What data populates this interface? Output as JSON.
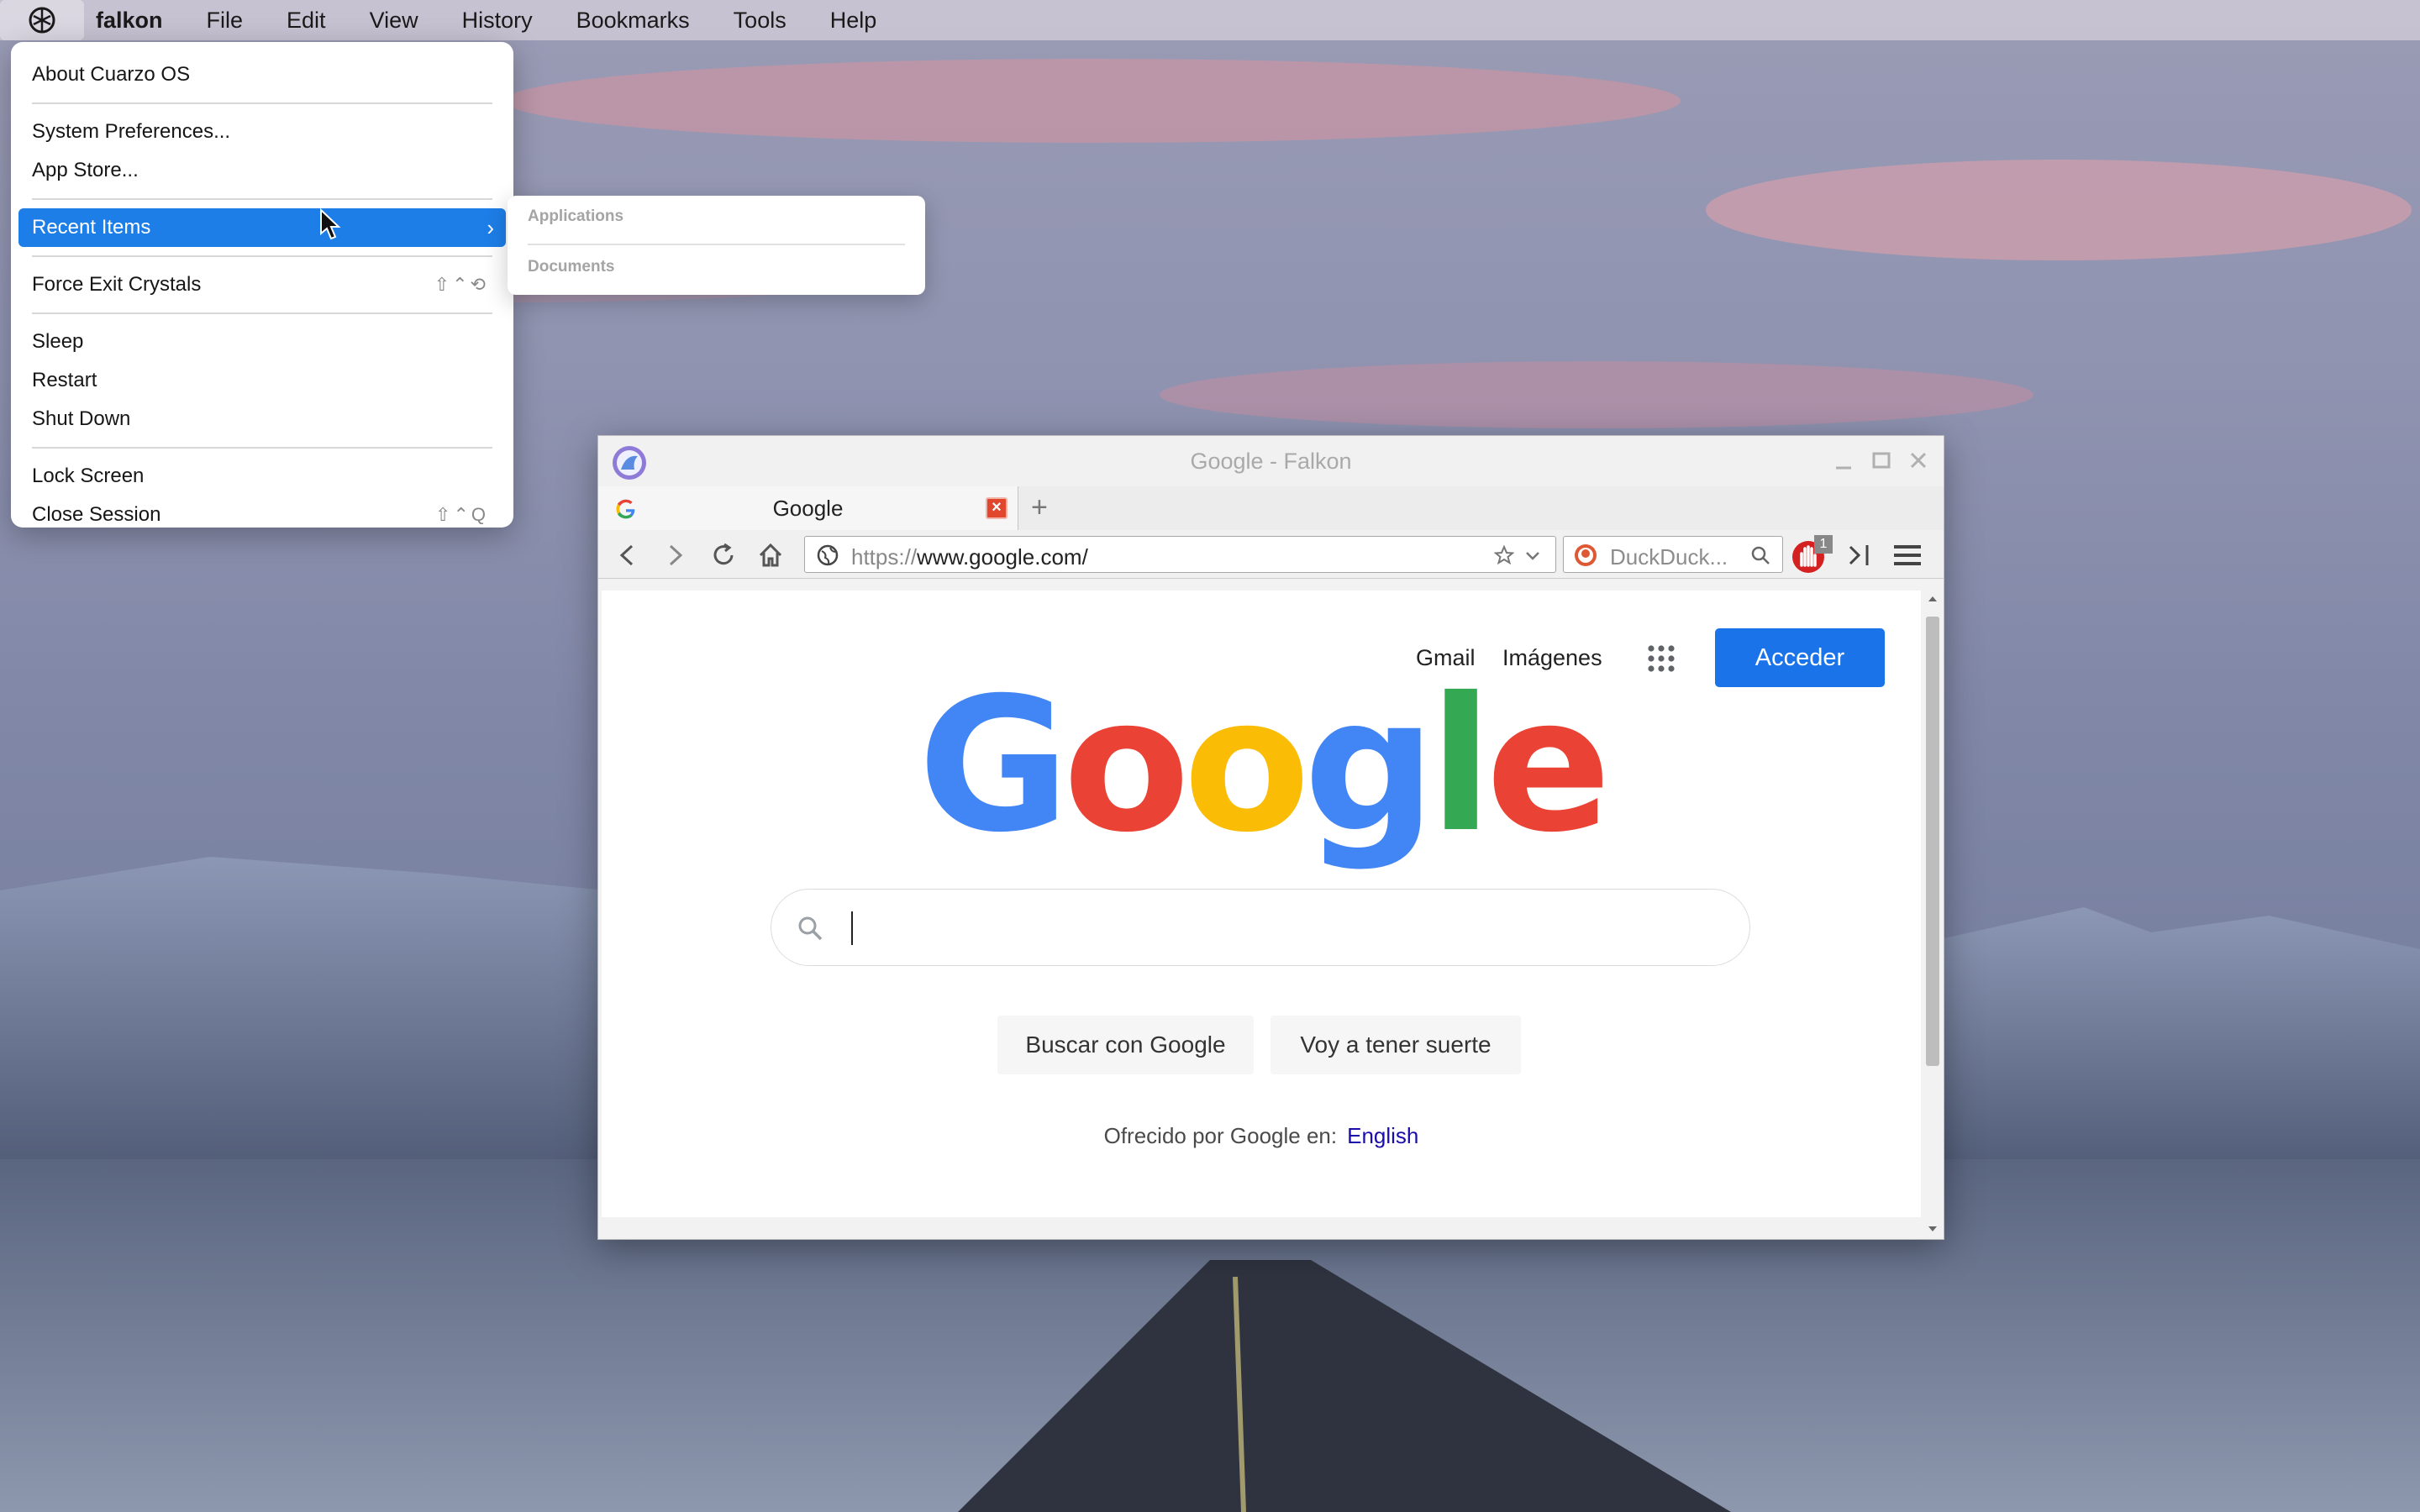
{
  "menubar": {
    "app_name": "falkon",
    "items": [
      "File",
      "Edit",
      "View",
      "History",
      "Bookmarks",
      "Tools",
      "Help"
    ]
  },
  "system_menu": {
    "about": "About Cuarzo OS",
    "system_preferences": "System Preferences...",
    "app_store": "App Store...",
    "recent_items": "Recent Items",
    "force_exit": "Force Exit Crystals",
    "force_exit_shortcut": "⇧⌃⟲",
    "sleep": "Sleep",
    "restart": "Restart",
    "shut_down": "Shut Down",
    "lock_screen": "Lock Screen",
    "close_session": "Close Session",
    "close_session_shortcut": "⇧⌃Q"
  },
  "recent_submenu": {
    "applications": "Applications",
    "documents": "Documents"
  },
  "window": {
    "title": "Google - Falkon",
    "tab_title": "Google",
    "new_tab_symbol": "+",
    "url_scheme": "https://",
    "url_host": "www.google.com/",
    "search_placeholder": "DuckDuck...",
    "adblock_count": "1"
  },
  "page": {
    "gmail": "Gmail",
    "imagenes": "Imágenes",
    "acceder": "Acceder",
    "logo_letters": [
      {
        "ch": "G",
        "color": "#4285f4"
      },
      {
        "ch": "o",
        "color": "#ea4335"
      },
      {
        "ch": "o",
        "color": "#fbbc05"
      },
      {
        "ch": "g",
        "color": "#4285f4"
      },
      {
        "ch": "l",
        "color": "#34a853"
      },
      {
        "ch": "e",
        "color": "#ea4335"
      }
    ],
    "search_button": "Buscar con Google",
    "lucky_button": "Voy a tener suerte",
    "offered_in": "Ofrecido por Google en:",
    "language_link": "English"
  },
  "colors": {
    "accent": "#1d7ee8",
    "google_blue": "#1a73e8"
  }
}
